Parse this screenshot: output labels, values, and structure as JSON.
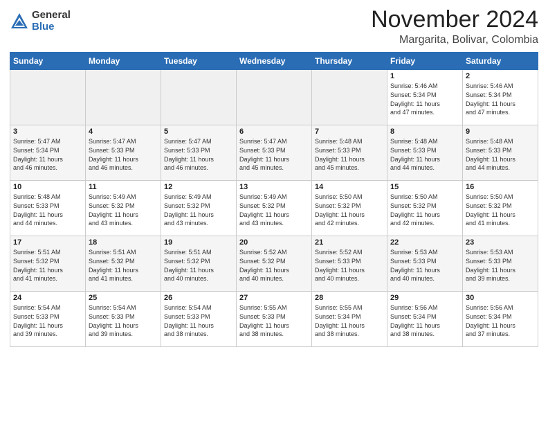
{
  "header": {
    "logo_general": "General",
    "logo_blue": "Blue",
    "month_title": "November 2024",
    "location": "Margarita, Bolivar, Colombia"
  },
  "weekdays": [
    "Sunday",
    "Monday",
    "Tuesday",
    "Wednesday",
    "Thursday",
    "Friday",
    "Saturday"
  ],
  "weeks": [
    [
      {
        "day": "",
        "info": ""
      },
      {
        "day": "",
        "info": ""
      },
      {
        "day": "",
        "info": ""
      },
      {
        "day": "",
        "info": ""
      },
      {
        "day": "",
        "info": ""
      },
      {
        "day": "1",
        "info": "Sunrise: 5:46 AM\nSunset: 5:34 PM\nDaylight: 11 hours\nand 47 minutes."
      },
      {
        "day": "2",
        "info": "Sunrise: 5:46 AM\nSunset: 5:34 PM\nDaylight: 11 hours\nand 47 minutes."
      }
    ],
    [
      {
        "day": "3",
        "info": "Sunrise: 5:47 AM\nSunset: 5:34 PM\nDaylight: 11 hours\nand 46 minutes."
      },
      {
        "day": "4",
        "info": "Sunrise: 5:47 AM\nSunset: 5:33 PM\nDaylight: 11 hours\nand 46 minutes."
      },
      {
        "day": "5",
        "info": "Sunrise: 5:47 AM\nSunset: 5:33 PM\nDaylight: 11 hours\nand 46 minutes."
      },
      {
        "day": "6",
        "info": "Sunrise: 5:47 AM\nSunset: 5:33 PM\nDaylight: 11 hours\nand 45 minutes."
      },
      {
        "day": "7",
        "info": "Sunrise: 5:48 AM\nSunset: 5:33 PM\nDaylight: 11 hours\nand 45 minutes."
      },
      {
        "day": "8",
        "info": "Sunrise: 5:48 AM\nSunset: 5:33 PM\nDaylight: 11 hours\nand 44 minutes."
      },
      {
        "day": "9",
        "info": "Sunrise: 5:48 AM\nSunset: 5:33 PM\nDaylight: 11 hours\nand 44 minutes."
      }
    ],
    [
      {
        "day": "10",
        "info": "Sunrise: 5:48 AM\nSunset: 5:33 PM\nDaylight: 11 hours\nand 44 minutes."
      },
      {
        "day": "11",
        "info": "Sunrise: 5:49 AM\nSunset: 5:32 PM\nDaylight: 11 hours\nand 43 minutes."
      },
      {
        "day": "12",
        "info": "Sunrise: 5:49 AM\nSunset: 5:32 PM\nDaylight: 11 hours\nand 43 minutes."
      },
      {
        "day": "13",
        "info": "Sunrise: 5:49 AM\nSunset: 5:32 PM\nDaylight: 11 hours\nand 43 minutes."
      },
      {
        "day": "14",
        "info": "Sunrise: 5:50 AM\nSunset: 5:32 PM\nDaylight: 11 hours\nand 42 minutes."
      },
      {
        "day": "15",
        "info": "Sunrise: 5:50 AM\nSunset: 5:32 PM\nDaylight: 11 hours\nand 42 minutes."
      },
      {
        "day": "16",
        "info": "Sunrise: 5:50 AM\nSunset: 5:32 PM\nDaylight: 11 hours\nand 41 minutes."
      }
    ],
    [
      {
        "day": "17",
        "info": "Sunrise: 5:51 AM\nSunset: 5:32 PM\nDaylight: 11 hours\nand 41 minutes."
      },
      {
        "day": "18",
        "info": "Sunrise: 5:51 AM\nSunset: 5:32 PM\nDaylight: 11 hours\nand 41 minutes."
      },
      {
        "day": "19",
        "info": "Sunrise: 5:51 AM\nSunset: 5:32 PM\nDaylight: 11 hours\nand 40 minutes."
      },
      {
        "day": "20",
        "info": "Sunrise: 5:52 AM\nSunset: 5:32 PM\nDaylight: 11 hours\nand 40 minutes."
      },
      {
        "day": "21",
        "info": "Sunrise: 5:52 AM\nSunset: 5:33 PM\nDaylight: 11 hours\nand 40 minutes."
      },
      {
        "day": "22",
        "info": "Sunrise: 5:53 AM\nSunset: 5:33 PM\nDaylight: 11 hours\nand 40 minutes."
      },
      {
        "day": "23",
        "info": "Sunrise: 5:53 AM\nSunset: 5:33 PM\nDaylight: 11 hours\nand 39 minutes."
      }
    ],
    [
      {
        "day": "24",
        "info": "Sunrise: 5:54 AM\nSunset: 5:33 PM\nDaylight: 11 hours\nand 39 minutes."
      },
      {
        "day": "25",
        "info": "Sunrise: 5:54 AM\nSunset: 5:33 PM\nDaylight: 11 hours\nand 39 minutes."
      },
      {
        "day": "26",
        "info": "Sunrise: 5:54 AM\nSunset: 5:33 PM\nDaylight: 11 hours\nand 38 minutes."
      },
      {
        "day": "27",
        "info": "Sunrise: 5:55 AM\nSunset: 5:33 PM\nDaylight: 11 hours\nand 38 minutes."
      },
      {
        "day": "28",
        "info": "Sunrise: 5:55 AM\nSunset: 5:34 PM\nDaylight: 11 hours\nand 38 minutes."
      },
      {
        "day": "29",
        "info": "Sunrise: 5:56 AM\nSunset: 5:34 PM\nDaylight: 11 hours\nand 38 minutes."
      },
      {
        "day": "30",
        "info": "Sunrise: 5:56 AM\nSunset: 5:34 PM\nDaylight: 11 hours\nand 37 minutes."
      }
    ]
  ]
}
